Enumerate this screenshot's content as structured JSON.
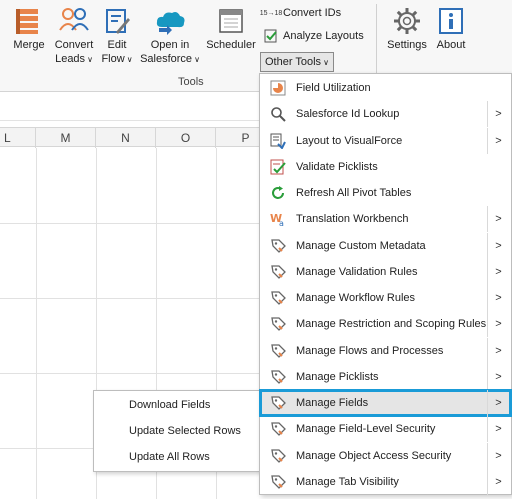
{
  "ribbon": {
    "merge": "Merge",
    "convert_leads_1": "Convert",
    "convert_leads_2": "Leads",
    "edit_flow_1": "Edit",
    "edit_flow_2": "Flow",
    "open_sf_1": "Open in",
    "open_sf_2": "Salesforce",
    "scheduler": "Scheduler",
    "convert_ids": "Convert IDs",
    "convert_ids_glyph": "15→18",
    "analyze_layouts": "Analyze Layouts",
    "other_tools": "Other Tools",
    "settings": "Settings",
    "about": "About",
    "tools_group": "Tools",
    "caret": "∨"
  },
  "columns": [
    "L",
    "M",
    "N",
    "O",
    "P"
  ],
  "menu": {
    "items": [
      {
        "label": "Field Utilization",
        "icon": "field-utilization-icon",
        "submenu": false
      },
      {
        "label": "Salesforce Id Lookup",
        "icon": "search-icon",
        "submenu": true
      },
      {
        "label": "Layout to VisualForce",
        "icon": "layout-icon",
        "submenu": true
      },
      {
        "label": "Validate Picklists",
        "icon": "validate-icon",
        "submenu": false
      },
      {
        "label": "Refresh All Pivot Tables",
        "icon": "refresh-icon",
        "submenu": false
      },
      {
        "label": "Translation Workbench",
        "icon": "translation-icon",
        "submenu": true
      },
      {
        "label": "Manage Custom Metadata",
        "icon": "tag-icon",
        "submenu": true
      },
      {
        "label": "Manage Validation Rules",
        "icon": "tag-icon",
        "submenu": true
      },
      {
        "label": "Manage Workflow Rules",
        "icon": "tag-icon",
        "submenu": true
      },
      {
        "label": "Manage Restriction and Scoping Rules",
        "icon": "tag-icon",
        "submenu": true
      },
      {
        "label": "Manage Flows and Processes",
        "icon": "tag-icon",
        "submenu": true
      },
      {
        "label": "Manage Picklists",
        "icon": "tag-icon",
        "submenu": true
      },
      {
        "label": "Manage Fields",
        "icon": "tag-icon",
        "submenu": true
      },
      {
        "label": "Manage Field-Level Security",
        "icon": "tag-icon",
        "submenu": true
      },
      {
        "label": "Manage Object Access Security",
        "icon": "tag-icon",
        "submenu": true
      },
      {
        "label": "Manage Tab Visibility",
        "icon": "tag-icon",
        "submenu": true
      }
    ],
    "arrow": ">",
    "highlighted": "Manage Fields",
    "highlight_color": "#1a9bd7"
  },
  "flyout": {
    "items": [
      "Download Fields",
      "Update Selected Rows",
      "Update All Rows"
    ]
  }
}
